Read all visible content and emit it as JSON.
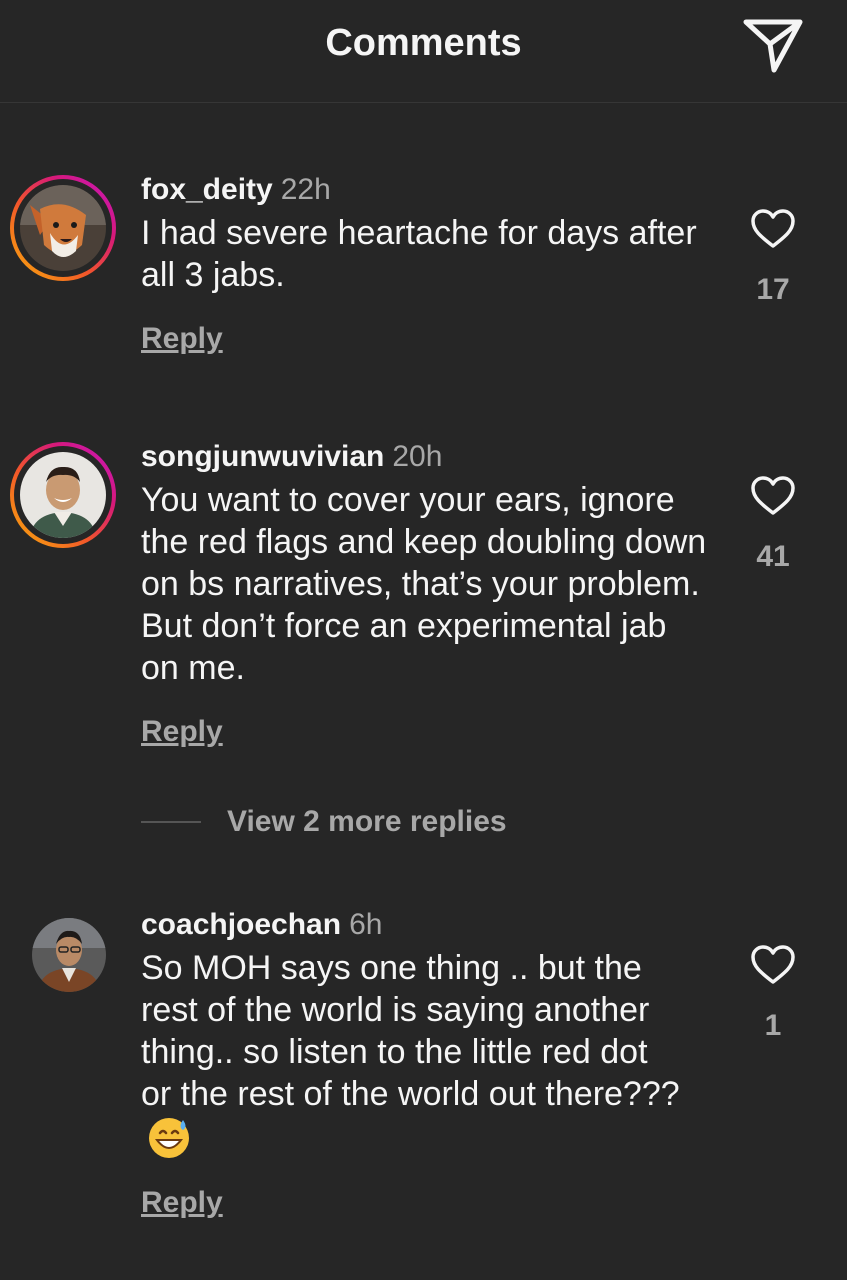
{
  "header": {
    "title": "Comments",
    "send_icon": "paper-plane-icon"
  },
  "comments": [
    {
      "username": "fox_deity",
      "time": "22h",
      "text": "I had severe heartache for days after all 3 jabs.",
      "likes": "17",
      "reply_label": "Reply",
      "avatar": "fox-avatar",
      "has_story_ring": true
    },
    {
      "username": "songjunwuvivian",
      "time": "20h",
      "text": "You want to cover your ears, ignore the red flags and keep doubling down on bs narratives, that’s your problem. But don’t force an experimental jab on me.",
      "likes": "41",
      "reply_label": "Reply",
      "avatar": "smiling-man-avatar",
      "has_story_ring": true,
      "view_more": "View 2 more replies"
    },
    {
      "username": "coachjoechan",
      "time": "6h",
      "text": "So MOH says one thing .. but the rest of the world is saying another thing.. so listen to the little red dot or the rest of the world out there???",
      "emoji": "grinning-face-with-sweat-emoji",
      "likes": "1",
      "reply_label": "Reply",
      "avatar": "man-in-jacket-avatar",
      "has_story_ring": false
    }
  ],
  "colors": {
    "background": "#262626",
    "primary_text": "#f5f5f5",
    "secondary_text": "#a8a8a8"
  }
}
